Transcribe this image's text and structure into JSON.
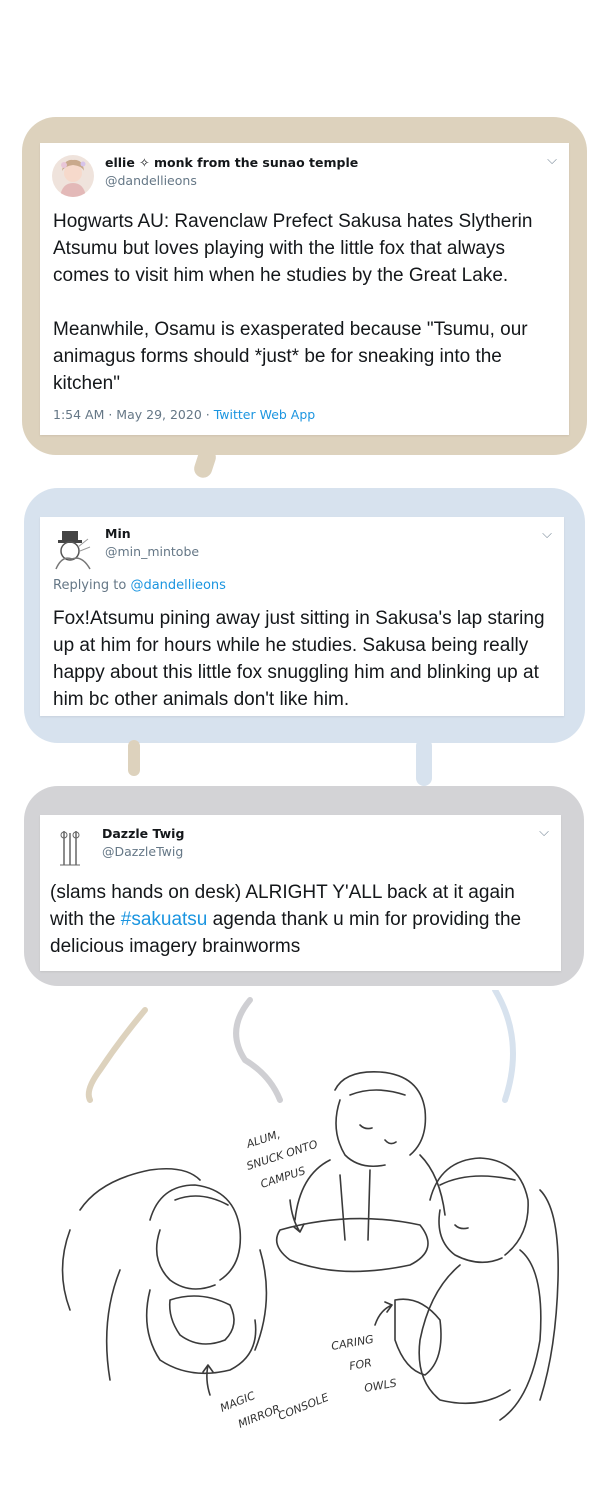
{
  "tweets": [
    {
      "author_name": "ellie ✧ monk from the sunao temple",
      "handle": "@dandellieons",
      "body_p1": "Hogwarts AU: Ravenclaw Prefect Sakusa hates Slytherin Atsumu but loves playing with the little fox that always comes to visit him when he studies by the Great Lake.",
      "body_p2": "Meanwhile, Osamu is exasperated because \"Tsumu, our animagus forms should *just* be for sneaking into the kitchen\"",
      "timestamp": "1:54 AM · May 29, 2020 · ",
      "source": "Twitter Web App"
    },
    {
      "author_name": "Min",
      "handle": "@min_mintobe",
      "replying_prefix": "Replying to ",
      "replying_to": "@dandellieons",
      "body": "Fox!Atsumu pining away just sitting in Sakusa's lap staring up at him for hours while he studies. Sakusa being really happy about this little fox snuggling him and blinking up at him bc other animals don't like him."
    },
    {
      "author_name": "Dazzle Twig",
      "handle": "@DazzleTwig",
      "body_pre": "(slams hands on desk) ALRIGHT Y'ALL back at it again with the ",
      "hashtag": "#sakuatsu",
      "body_post": " agenda thank u min for providing the delicious imagery brainworms"
    }
  ],
  "sketch_annotations": {
    "alum": "ALUM,",
    "snuck": "SNUCK ONTO",
    "campus": "CAMPUS",
    "caring": "CARING",
    "for": "FOR",
    "owls": "OWLS",
    "magic": "MAGIC",
    "mirror": "MIRROR",
    "console": "CONSOLE"
  },
  "icons": [
    "chevron-down-icon",
    "avatar"
  ],
  "colors": {
    "bubble_1": "#ddd2bd",
    "bubble_2": "#d7e2ee",
    "bubble_3": "#d3d3d6",
    "link": "#1b95e0",
    "secondary_text": "#657786"
  }
}
